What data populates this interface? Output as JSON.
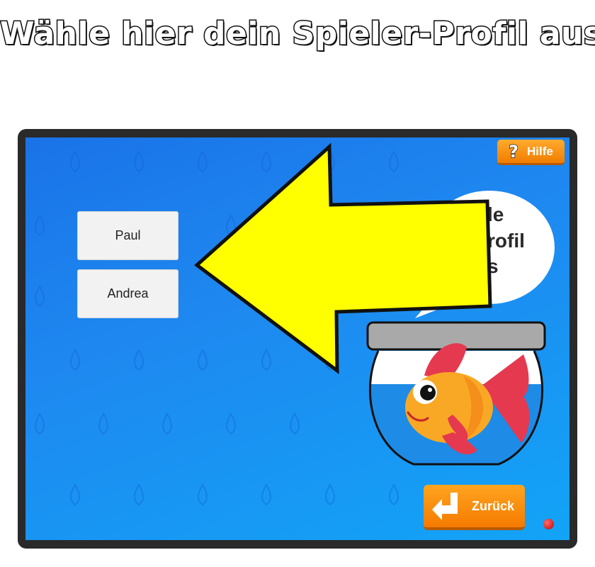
{
  "headline": "Wähle hier dein Spieler-Profil aus",
  "profiles": [
    "Paul",
    "Andrea"
  ],
  "help_button": {
    "label": "Hilfe",
    "icon_glyph": "?"
  },
  "back_button": {
    "label": "Zurück"
  },
  "speech_bubble_fragments": [
    "le",
    "rofil",
    "s"
  ],
  "colors": {
    "screen_blue": "#1e88f0",
    "button_orange": "#f68b00",
    "arrow_yellow": "#ffff00",
    "fish_orange": "#f9a825",
    "fin_red": "#e53950"
  }
}
